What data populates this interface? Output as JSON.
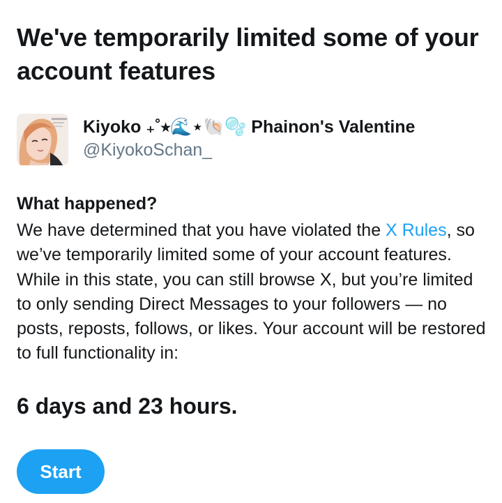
{
  "title": "We've temporarily limited some of your account features",
  "account": {
    "display_name": "Kiyoko ₊˚⭒🌊⋆🐚🫧 Phainon's Valentine",
    "handle": "@KiyokoSchan_",
    "avatar_icon": "avatar"
  },
  "section": {
    "heading": "What happened?",
    "body_before_link": "We have determined that you have violated the ",
    "link_text": "X Rules",
    "body_after_link": ", so we’ve temporarily limited some of your account features. While in this state, you can still browse X, but you’re limited to only sending Direct Messages to your followers — no posts, reposts, follows, or likes. Your account will be restored to full functionality in:"
  },
  "duration": "6 days and 23 hours.",
  "start_button": {
    "label": "Start"
  },
  "colors": {
    "accent": "#1da1f2",
    "text": "#14171a",
    "secondary_text": "#657786",
    "background": "#ffffff"
  }
}
